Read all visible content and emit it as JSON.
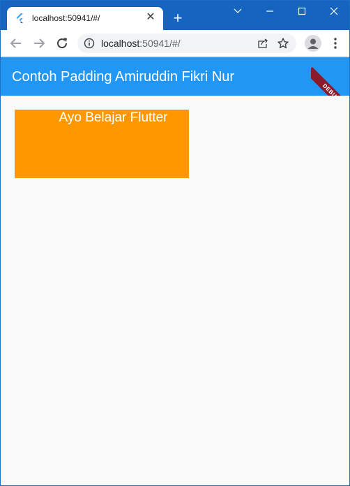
{
  "browser": {
    "tab": {
      "title": "localhost:50941/#/",
      "favicon": "flutter-icon",
      "close_icon": "close-icon"
    },
    "new_tab_icon": "plus-icon",
    "window_controls": [
      "chevron-down-icon",
      "minimize-icon",
      "maximize-icon",
      "close-icon"
    ],
    "toolbar": {
      "back_icon": "back-arrow-icon",
      "forward_icon": "forward-arrow-icon",
      "reload_icon": "reload-icon",
      "address": {
        "host": "localhost",
        "rest": ":50941/#/"
      },
      "info_icon": "info-icon",
      "share_icon": "share-icon",
      "bookmark_icon": "star-icon",
      "profile_icon": "avatar-icon",
      "menu_icon": "menu-dots-icon"
    },
    "colors": {
      "tabstrip": "#1565c0",
      "toolbar": "#ffffff",
      "omnibox": "#f1f3f4"
    }
  },
  "app": {
    "appbar": {
      "title": "Contoh Padding Amiruddin Fikri Nur",
      "color": "#2196f3"
    },
    "debug_banner": "DEBUG",
    "box": {
      "text": "Ayo Belajar Flutter",
      "color": "#ff9800"
    },
    "background": "#fafafa"
  }
}
